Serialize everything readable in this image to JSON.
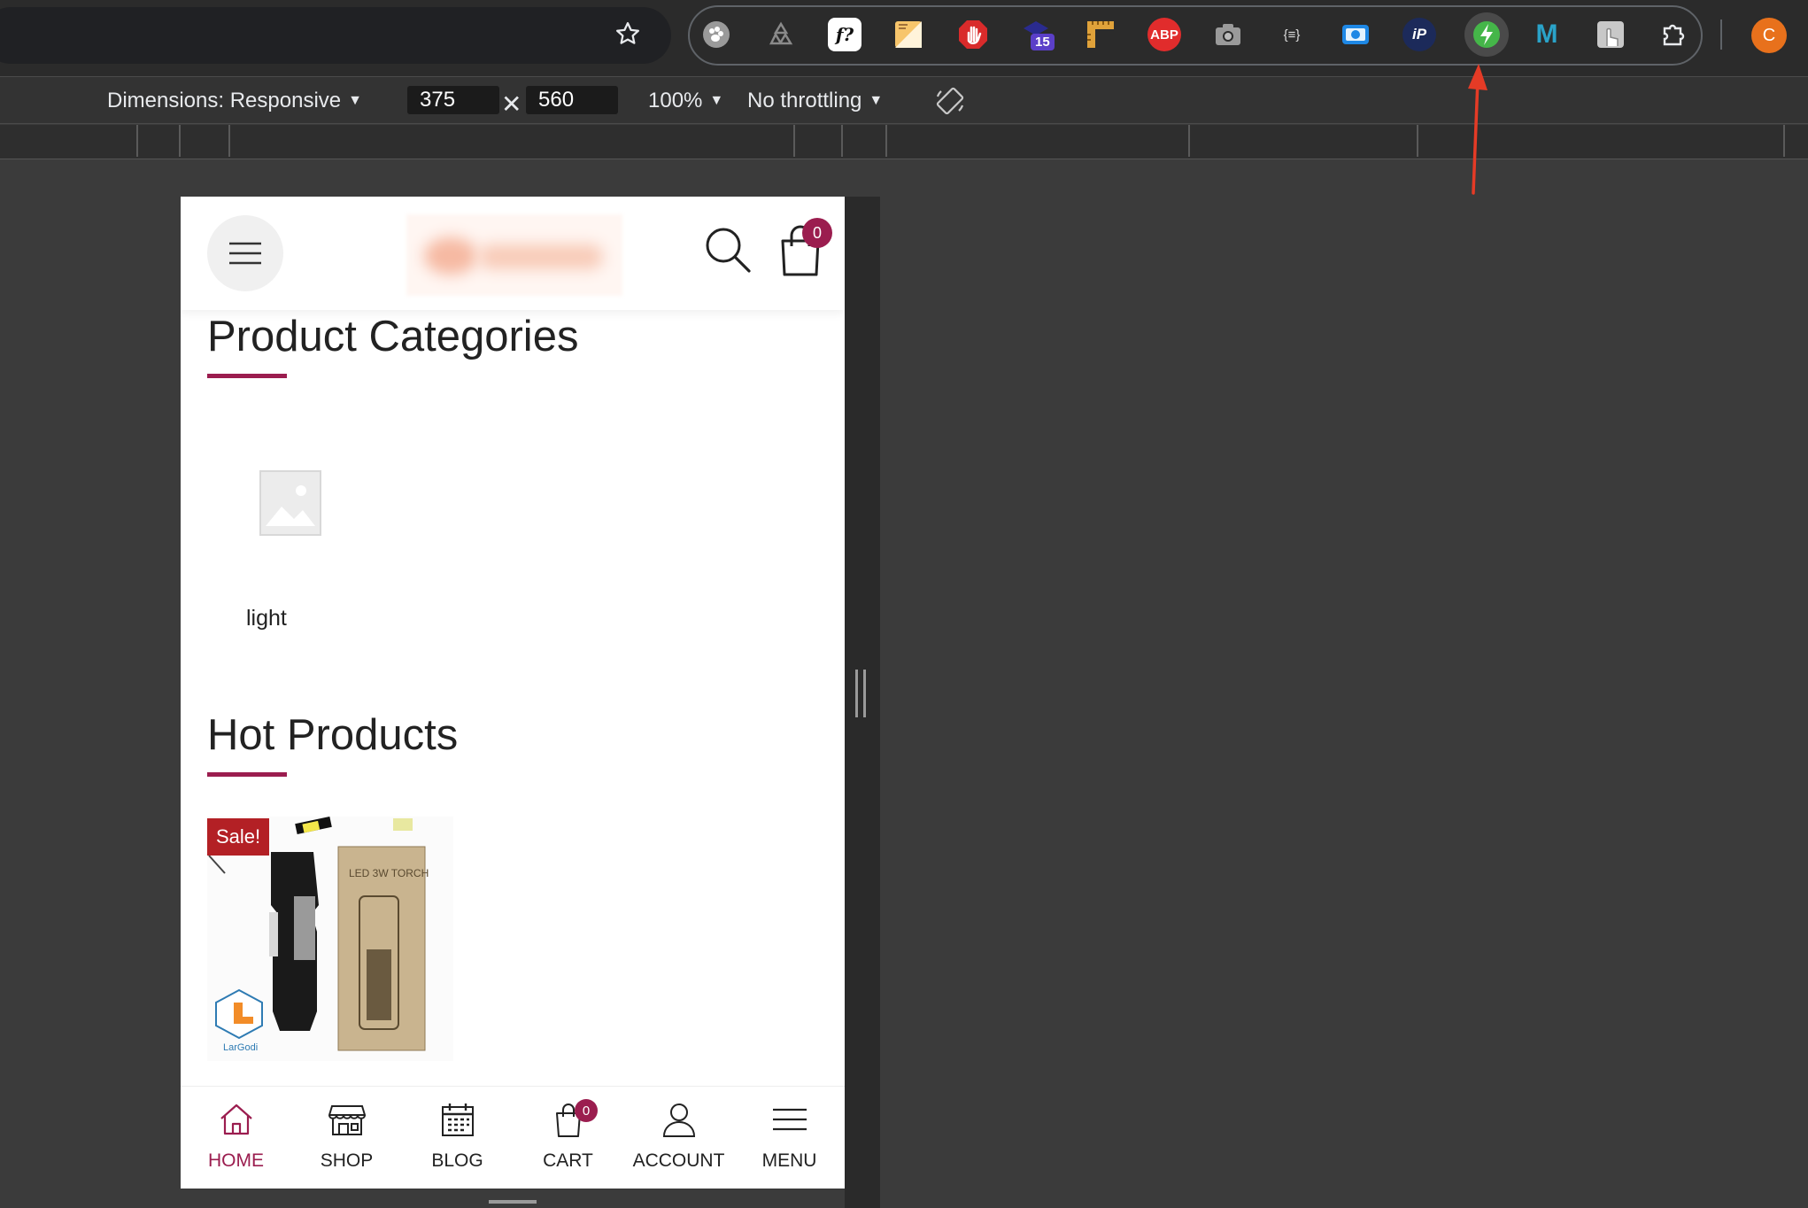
{
  "browser": {
    "extensions": [
      {
        "name": "paw-extension-icon",
        "label": ""
      },
      {
        "name": "recycle-extension-icon",
        "label": ""
      },
      {
        "name": "font-identify-extension-icon",
        "label": "f?"
      },
      {
        "name": "notes-extension-icon",
        "label": ""
      },
      {
        "name": "stop-hand-extension-icon",
        "label": ""
      },
      {
        "name": "tab-counter-extension-icon",
        "label": "",
        "badge": "15"
      },
      {
        "name": "ruler-extension-icon",
        "label": ""
      },
      {
        "name": "adblock-extension-icon",
        "label": "ABP"
      },
      {
        "name": "screenshot-extension-icon",
        "label": ""
      },
      {
        "name": "json-extension-icon",
        "label": "{≡}"
      },
      {
        "name": "screen-record-extension-icon",
        "label": ""
      },
      {
        "name": "ip-extension-icon",
        "label": "iP"
      },
      {
        "name": "speed-extension-icon",
        "label": ""
      },
      {
        "name": "m-extension-icon",
        "label": "M"
      },
      {
        "name": "touch-extension-icon",
        "label": ""
      },
      {
        "name": "puzzle-extensions-icon",
        "label": ""
      }
    ],
    "profile_initial": "C"
  },
  "devtools": {
    "dimensions_label": "Dimensions: Responsive",
    "width": "375",
    "height": "560",
    "zoom": "100%",
    "throttling": "No throttling"
  },
  "site": {
    "cart_count": "0",
    "categories_title": "Product Categories",
    "category_name": "light",
    "hot_title": "Hot Products",
    "sale_badge": "Sale!",
    "product_box_text": "LED 3W TORCH",
    "product_logo_text": "LarGodi",
    "nav": [
      {
        "label": "HOME",
        "active": true
      },
      {
        "label": "SHOP"
      },
      {
        "label": "BLOG"
      },
      {
        "label": "CART",
        "badge": "0"
      },
      {
        "label": "ACCOUNT"
      },
      {
        "label": "MENU"
      }
    ]
  },
  "colors": {
    "accent": "#9b1d4f",
    "sale": "#b32025",
    "annotation_arrow": "#e53b26"
  }
}
